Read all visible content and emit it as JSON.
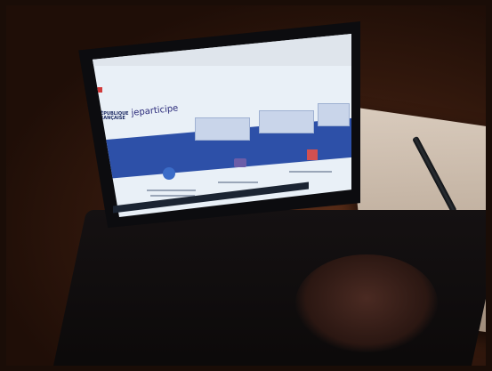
{
  "scene": {
    "description_tags": [
      "laptop",
      "website-on-screen",
      "notebook",
      "pen",
      "hand",
      "dim-room"
    ]
  },
  "screen": {
    "brand_lines": [
      "RÉPUBLIQUE",
      "FRANÇAISE"
    ],
    "site_name": "jeparticipe"
  },
  "colors": {
    "banner": "#2d50a8",
    "screen_bg": "#e9f0f7",
    "room": "#3a1c0f",
    "notebook": "#cbbcae"
  }
}
